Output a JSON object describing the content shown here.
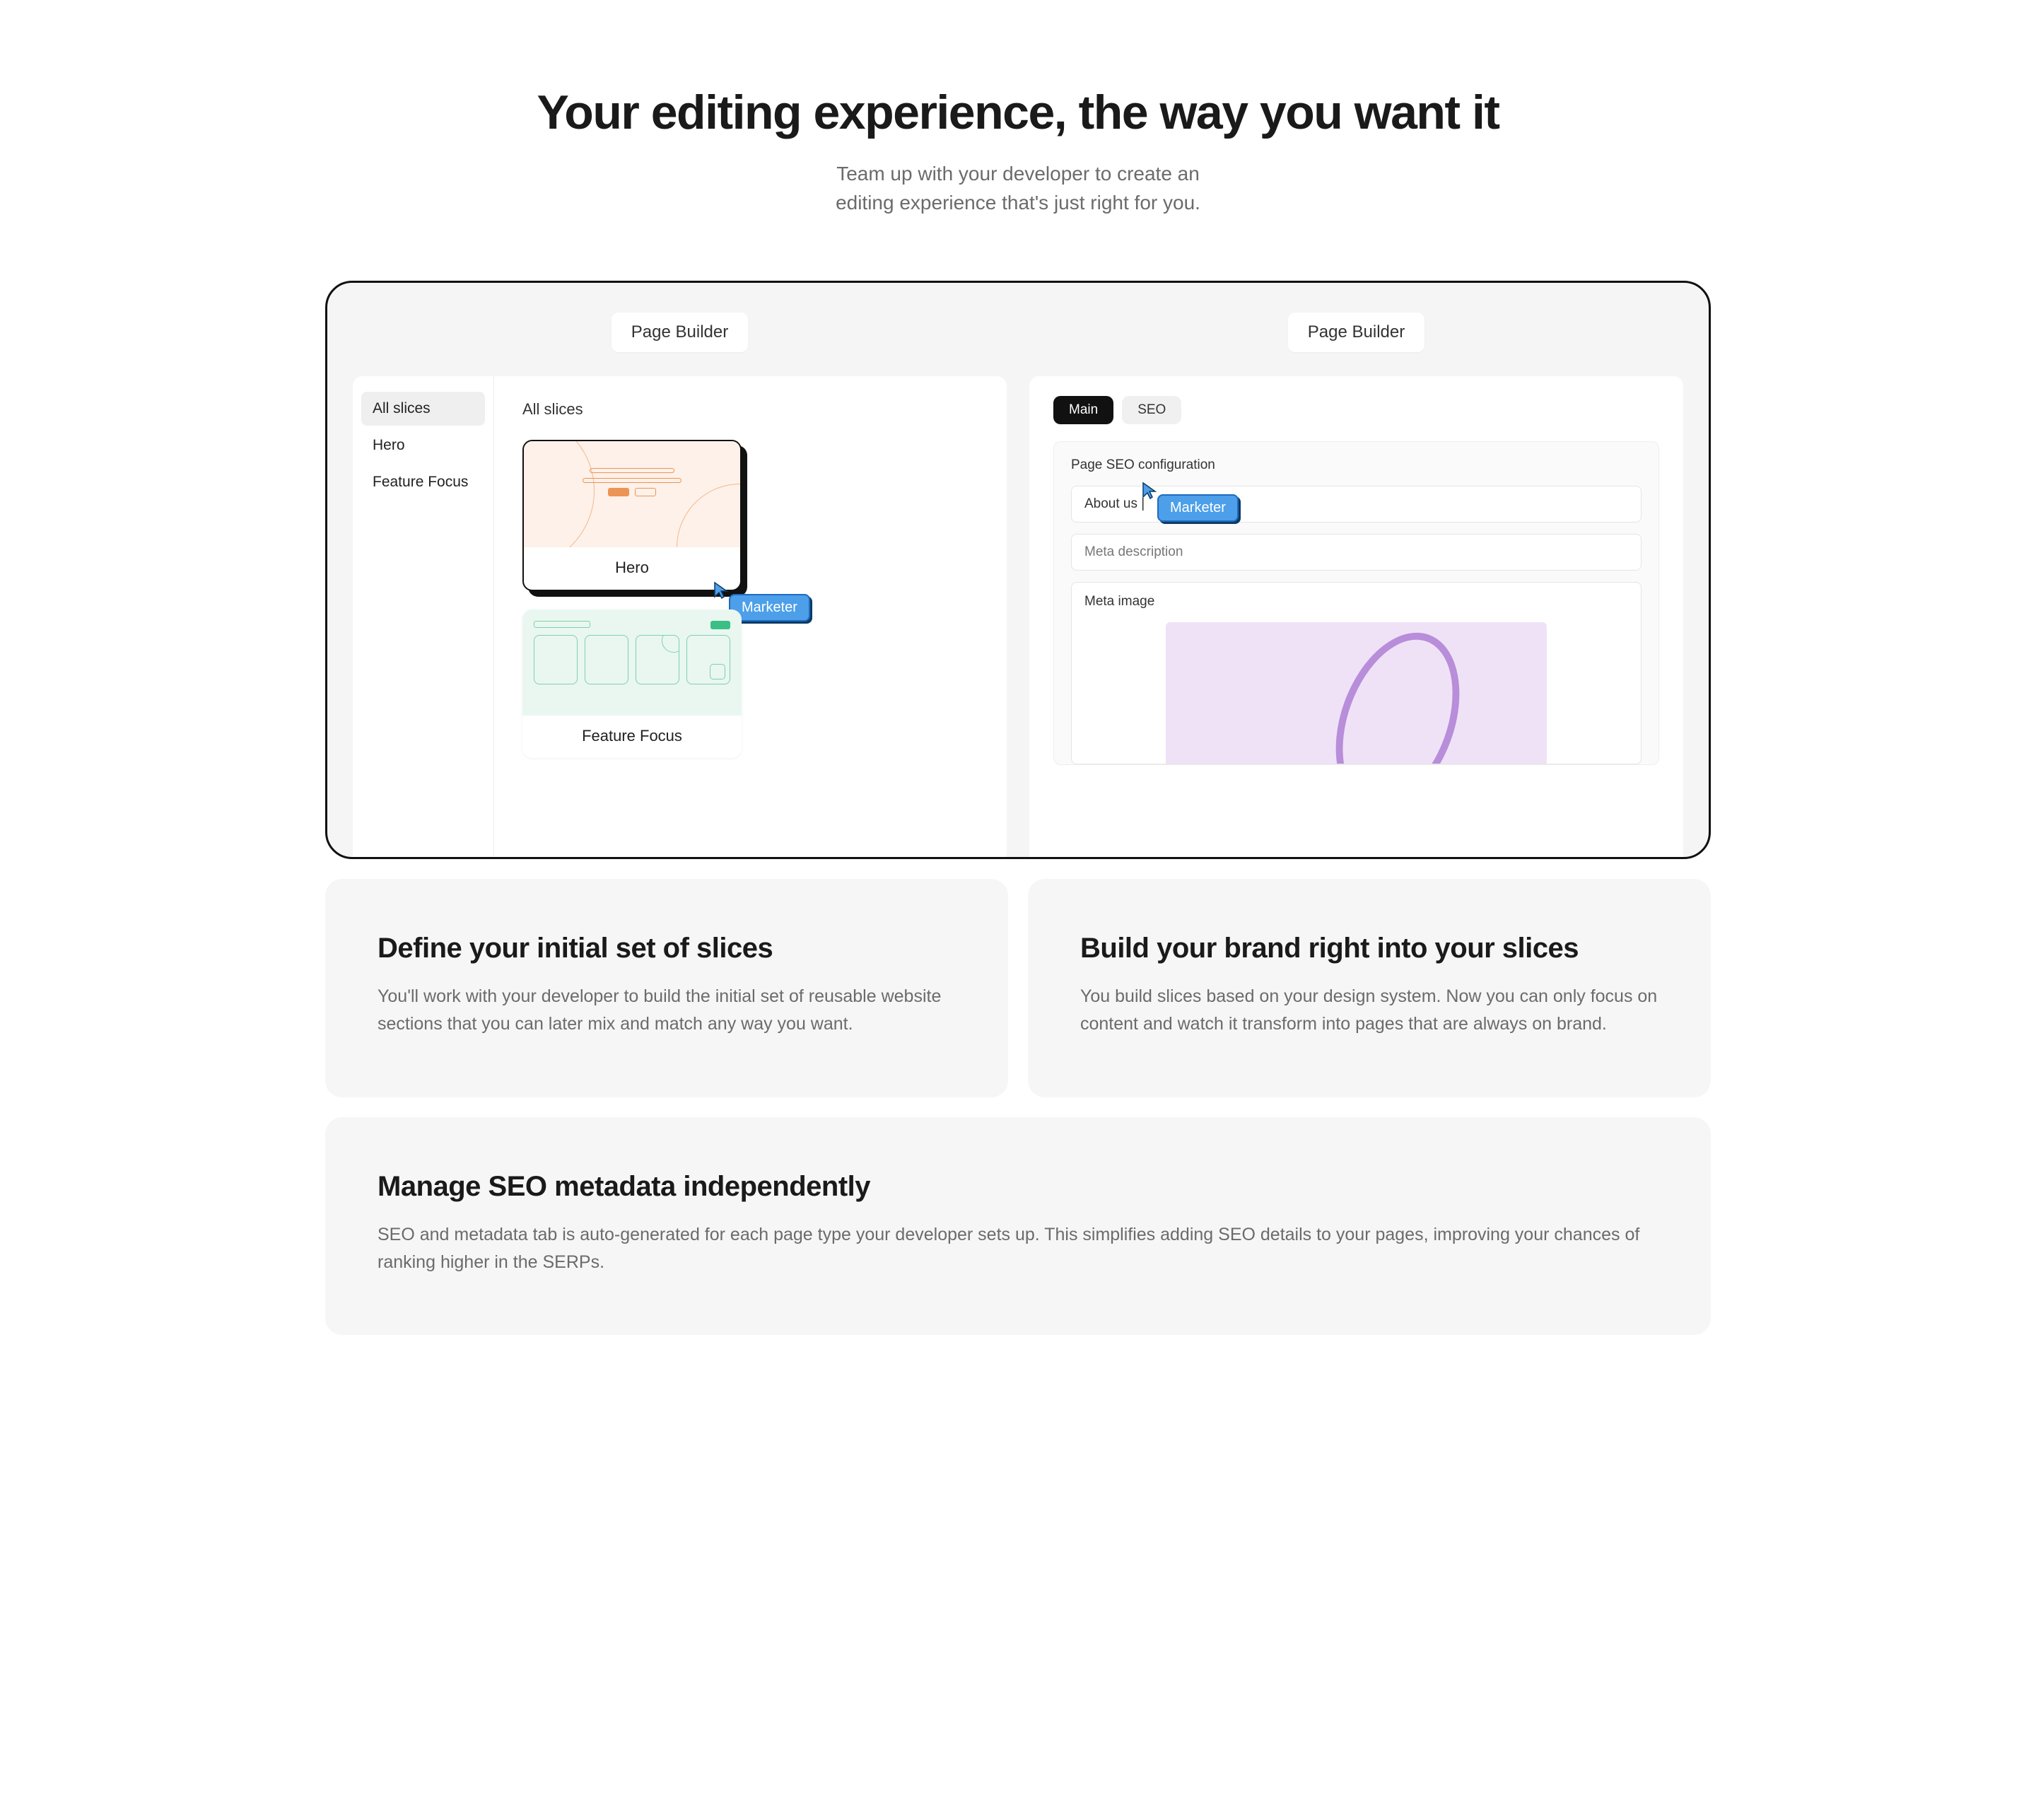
{
  "header": {
    "title": "Your editing experience, the way you want it",
    "subtitle_line1": "Team up with your developer to create an",
    "subtitle_line2": "editing experience that's just right for you."
  },
  "illustration": {
    "left": {
      "label": "Page Builder",
      "sidebar_items": [
        "All slices",
        "Hero",
        "Feature Focus"
      ],
      "main_heading": "All slices",
      "slices": [
        {
          "name": "Hero"
        },
        {
          "name": "Feature Focus"
        }
      ],
      "cursor_label": "Marketer"
    },
    "right": {
      "label": "Page Builder",
      "tabs": [
        "Main",
        "SEO"
      ],
      "box_title": "Page SEO configuration",
      "title_field_value": "About us |",
      "meta_description_placeholder": "Meta description",
      "meta_image_label": "Meta image",
      "cursor_label": "Marketer"
    }
  },
  "cards": [
    {
      "title": "Define your initial set of slices",
      "body": "You'll work with your developer to build the initial set of reusable website sections that you can later mix and match any way you want."
    },
    {
      "title": "Build your brand right into your slices",
      "body": "You build slices based on your design system. Now you can only focus on content and watch it transform into pages that are always on brand."
    }
  ],
  "card_full": {
    "title": "Manage SEO metadata independently",
    "body": "SEO and metadata tab is auto-generated for each page type your developer sets up. This simplifies adding SEO details to your pages, improving your chances of ranking higher in the SERPs."
  }
}
